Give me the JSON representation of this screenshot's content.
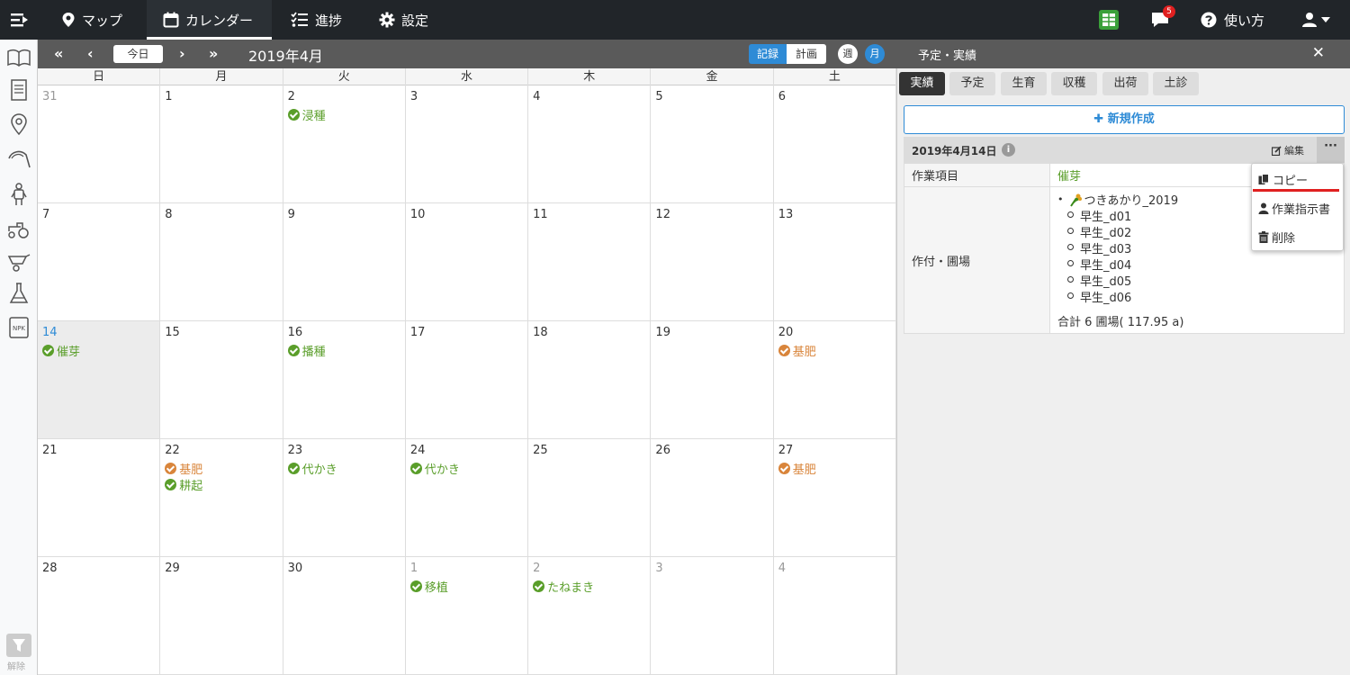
{
  "nav": {
    "items": [
      {
        "label": "マップ",
        "icon": "map-pin-icon"
      },
      {
        "label": "カレンダー",
        "icon": "calendar-icon"
      },
      {
        "label": "進捗",
        "icon": "checklist-icon"
      },
      {
        "label": "設定",
        "icon": "gear-icon"
      }
    ],
    "help_label": "使い方",
    "notification_count": "5"
  },
  "toolbar": {
    "today_label": "今日",
    "month_title": "2019年4月",
    "record_label": "記録",
    "plan_label": "計画",
    "week_label": "週",
    "month_label": "月"
  },
  "sidebar": {
    "filter_label": "解除"
  },
  "calendar": {
    "weekdays": [
      "日",
      "月",
      "火",
      "水",
      "木",
      "金",
      "土"
    ],
    "cells": [
      {
        "day": "31",
        "other": true,
        "events": []
      },
      {
        "day": "1",
        "events": []
      },
      {
        "day": "2",
        "events": [
          {
            "label": "浸種",
            "kind": "done"
          }
        ]
      },
      {
        "day": "3",
        "events": []
      },
      {
        "day": "4",
        "events": []
      },
      {
        "day": "5",
        "events": []
      },
      {
        "day": "6",
        "events": []
      },
      {
        "day": "7",
        "events": []
      },
      {
        "day": "8",
        "events": []
      },
      {
        "day": "9",
        "events": []
      },
      {
        "day": "10",
        "events": []
      },
      {
        "day": "11",
        "events": []
      },
      {
        "day": "12",
        "events": []
      },
      {
        "day": "13",
        "events": []
      },
      {
        "day": "14",
        "today": true,
        "events": [
          {
            "label": "催芽",
            "kind": "done"
          }
        ]
      },
      {
        "day": "15",
        "events": []
      },
      {
        "day": "16",
        "events": [
          {
            "label": "播種",
            "kind": "done"
          }
        ]
      },
      {
        "day": "17",
        "events": []
      },
      {
        "day": "18",
        "events": []
      },
      {
        "day": "19",
        "events": []
      },
      {
        "day": "20",
        "events": [
          {
            "label": "基肥",
            "kind": "fert"
          }
        ]
      },
      {
        "day": "21",
        "events": []
      },
      {
        "day": "22",
        "events": [
          {
            "label": "基肥",
            "kind": "fert"
          },
          {
            "label": "耕起",
            "kind": "done"
          }
        ]
      },
      {
        "day": "23",
        "events": [
          {
            "label": "代かき",
            "kind": "done"
          }
        ]
      },
      {
        "day": "24",
        "events": [
          {
            "label": "代かき",
            "kind": "done"
          }
        ]
      },
      {
        "day": "25",
        "events": []
      },
      {
        "day": "26",
        "events": []
      },
      {
        "day": "27",
        "events": [
          {
            "label": "基肥",
            "kind": "fert"
          }
        ]
      },
      {
        "day": "28",
        "events": []
      },
      {
        "day": "29",
        "events": []
      },
      {
        "day": "30",
        "events": []
      },
      {
        "day": "1",
        "other": true,
        "events": [
          {
            "label": "移植",
            "kind": "done"
          }
        ]
      },
      {
        "day": "2",
        "other": true,
        "events": [
          {
            "label": "たねまき",
            "kind": "done"
          }
        ]
      },
      {
        "day": "3",
        "other": true,
        "events": []
      },
      {
        "day": "4",
        "other": true,
        "events": []
      }
    ]
  },
  "panel": {
    "title": "予定・実績",
    "tabs": [
      "実績",
      "予定",
      "生育",
      "収穫",
      "出荷",
      "土診"
    ],
    "new_label": "新規作成",
    "record": {
      "date": "2019年4月14日",
      "edit_label": "編集",
      "work_item_label": "作業項目",
      "work_item_value": "催芽",
      "crop_field_label": "作付・圃場",
      "crop_name": "つきあかり_2019",
      "fields": [
        "早生_d01",
        "早生_d02",
        "早生_d03",
        "早生_d04",
        "早生_d05",
        "早生_d06"
      ],
      "total": "合計 6 圃場( 117.95 a)"
    },
    "dropdown": {
      "copy_label": "コピー",
      "instruction_label": "作業指示書",
      "delete_label": "削除"
    }
  },
  "colors": {
    "done": "#5a9e2a",
    "fert": "#d9853b",
    "accent": "#2e8bd6",
    "topbar": "#212529"
  }
}
